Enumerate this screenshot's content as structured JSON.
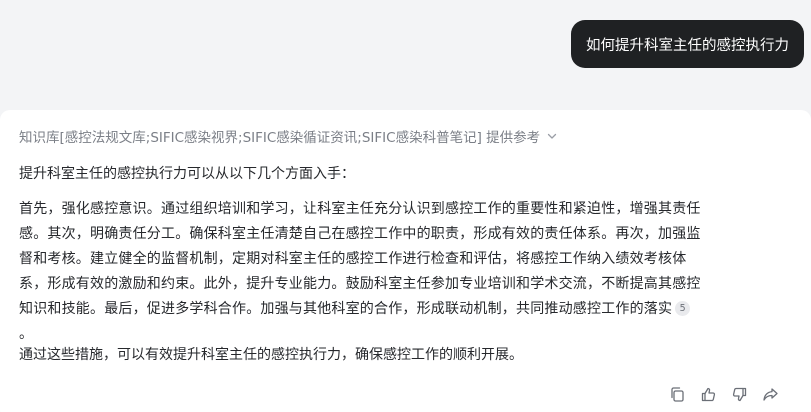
{
  "user_message": "如何提升科室主任的感控执行力",
  "answer": {
    "kb_source": "知识库[感控法规文库;SIFIC感染视界;SIFIC感染循证资讯;SIFIC感染科普笔记] 提供参考",
    "intro": "提升科室主任的感控执行力可以从以下几个方面入手：",
    "main_lines": [
      "首先，强化感控意识。通过组织培训和学习，让科室主任充分认识到感控工作的重要性和紧迫性，增强其责任",
      "感。其次，明确责任分工。确保科室主任清楚自己在感控工作中的职责，形成有效的责任体系。再次，加强监",
      "督和考核。建立健全的监督机制，定期对科室主任的感控工作进行检查和评估，将感控工作纳入绩效考核体",
      "系，形成有效的激励和约束。此外，提升专业能力。鼓励科室主任参加专业培训和学术交流，不断提高其感控",
      "知识和技能。最后，促进多学科合作。加强与其他科室的合作，形成联动机制，共同推动感控工作的落实",
      "。"
    ],
    "ref_number": "5",
    "conclusion": "通过这些措施，可以有效提升科室主任的感控执行力，确保感控工作的顺利开展。"
  },
  "actions": [
    {
      "icon": "copy-icon"
    },
    {
      "icon": "thumbs-up-icon"
    },
    {
      "icon": "thumbs-down-icon"
    },
    {
      "icon": "share-icon"
    }
  ],
  "colors": {
    "page_background": "#f3f4f6",
    "user_bubble": "#1f2123",
    "card": "#ffffff",
    "muted_text": "#7b7f87",
    "body_text": "#26282c"
  }
}
